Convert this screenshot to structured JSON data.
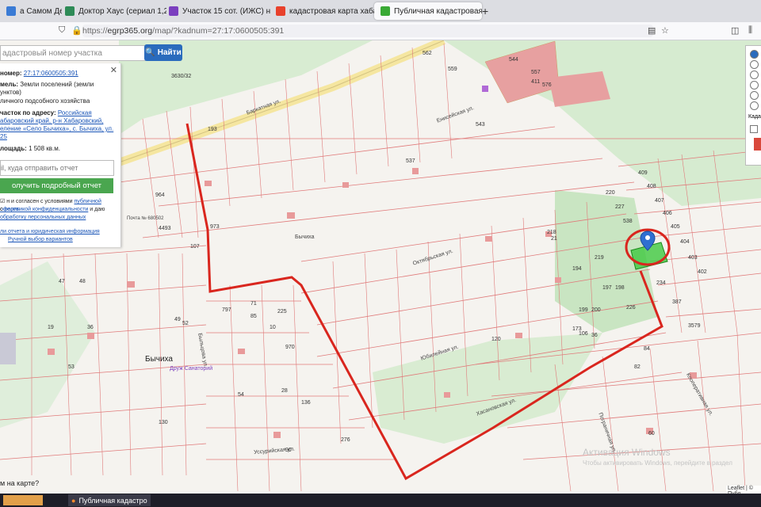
{
  "tabs": [
    {
      "label": "а Самом Деле Р",
      "color": "#3a7bd5"
    },
    {
      "label": "Доктор Хаус (сериал 1,2,3,4,5)",
      "color": "#2e8b57"
    },
    {
      "label": "Участок 15 сот. (ИЖС) на про",
      "color": "#7b3fbf"
    },
    {
      "label": "кадастровая карта хабаровск",
      "color": "#e8412c"
    },
    {
      "label": "Публичная кадастровая карта",
      "color": "#3aaa35"
    }
  ],
  "address_bar": {
    "prefix": "https://",
    "host": "egrp365.org",
    "path": "/map/?kadnum=27:17:0600505:391"
  },
  "search": {
    "placeholder": "адастровый номер участка",
    "button": "Найти"
  },
  "info_panel": {
    "cad_number_label": "номер:",
    "cad_number": "27:17:0600505:391",
    "category_label": "мель:",
    "category_value": "Земли поселений (земли",
    "category_value2": "унктов)",
    "use_value": "личного подсобного хозяйства",
    "address_label": "часток по адресу:",
    "address_lines": [
      "Российская",
      "абаровский край, р-н Хабаровский,",
      "еление «Село Бычиха», с. Бычиха, ул.",
      "25"
    ],
    "area_label": "лощадь:",
    "area_value": "1 508 кв.м.",
    "email_placeholder": "il, куда отправить отчет",
    "get_report": "олучить подробный отчет",
    "agree_text_1": "н и согласен с условиями",
    "agree_link_1": "публичной оферты",
    "agree_text_2": "с",
    "agree_link_2": "политикой конфиденциальности",
    "agree_text_3": "и даю",
    "agree_link_3": "обработку персональных данных",
    "bottom_link": "ли отчета и юридическая информация",
    "manual_choice": "Ручной выбор вариантов"
  },
  "map": {
    "village_label": "Бычиха",
    "sanatorium_label": "Друж Санаторий",
    "post_label": "Почта № 680502",
    "streets": [
      "Баркатная ул.",
      "Октябрьская ул.",
      "Юбилейная ул.",
      "Хасановская ул.",
      "Пограничная ул.",
      "Уссурийская ул.",
      "Кооперативная ул.",
      "Быльцова ул.",
      "Енисейская ул.",
      "Бычиха"
    ],
    "plot_labels": [
      "562",
      "559",
      "544",
      "557",
      "411",
      "576",
      "3630/32",
      "193",
      "543",
      "537",
      "225",
      "226",
      "218",
      "21",
      "964",
      "4493",
      "973",
      "107",
      "409",
      "408",
      "407",
      "406",
      "405",
      "404",
      "403",
      "402",
      "220",
      "227",
      "538",
      "234",
      "387",
      "3579",
      "197",
      "198",
      "199",
      "200",
      "219",
      "194",
      "84",
      "82",
      "797",
      "71",
      "85",
      "970",
      "90",
      "276",
      "47",
      "48",
      "36",
      "54",
      "10",
      "19",
      "28",
      "136",
      "130",
      "49",
      "52",
      "53",
      "60",
      "106",
      "120",
      "173",
      "36",
      "37"
    ]
  },
  "right_panel": {
    "label": "Када"
  },
  "watermark": {
    "line1": "Активация Windows",
    "line2": "Чтобы активировать Windows, перейдите в раздел"
  },
  "attribution": "Leaflet | © Публ",
  "ask_map": "м на карте?",
  "taskbar": {
    "app_label": "Публичная кадастро"
  }
}
